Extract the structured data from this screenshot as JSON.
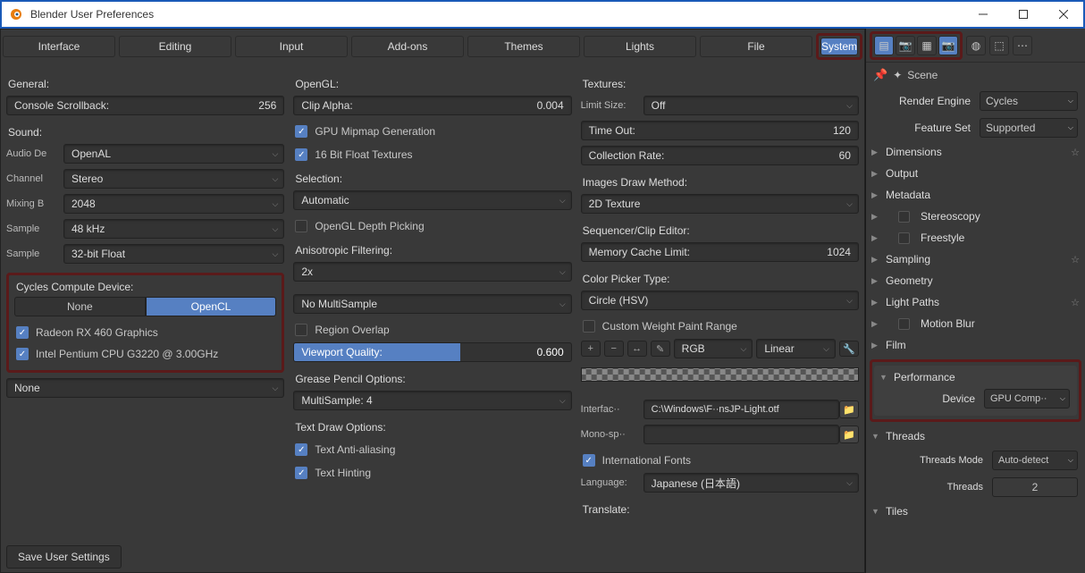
{
  "window_title": "Blender User Preferences",
  "tabs": [
    "Interface",
    "Editing",
    "Input",
    "Add-ons",
    "Themes",
    "Lights",
    "File",
    "System"
  ],
  "col1": {
    "general": "General:",
    "console_scrollback_label": "Console Scrollback:",
    "console_scrollback_value": "256",
    "sound": "Sound:",
    "audio_de_label": "Audio De",
    "audio_de_value": "OpenAL",
    "channel_label": "Channel",
    "channel_value": "Stereo",
    "mixing_label": "Mixing B",
    "mixing_value": "2048",
    "sample_rate_label": "Sample",
    "sample_rate_value": "48 kHz",
    "sample_fmt_label": "Sample",
    "sample_fmt_value": "32-bit Float",
    "compute_title": "Cycles Compute Device:",
    "compute_none": "None",
    "compute_opencl": "OpenCL",
    "device1": "Radeon RX 460 Graphics",
    "device2": "Intel Pentium CPU G3220 @ 3.00GHz",
    "none_select": "None"
  },
  "col2": {
    "opengl": "OpenGL:",
    "clip_alpha_label": "Clip Alpha:",
    "clip_alpha_value": "0.004",
    "gpu_mipmap": "GPU Mipmap Generation",
    "float_tex": "16 Bit Float Textures",
    "selection": "Selection:",
    "selection_value": "Automatic",
    "depth_picking": "OpenGL Depth Picking",
    "aniso": "Anisotropic Filtering:",
    "aniso_value": "2x",
    "multisample": "No MultiSample",
    "region_overlap": "Region Overlap",
    "viewport_quality_label": "Viewport Quality:",
    "viewport_quality_value": "0.600",
    "grease": "Grease Pencil Options:",
    "grease_value": "MultiSample: 4",
    "text_draw": "Text Draw Options:",
    "text_aa": "Text Anti-aliasing",
    "text_hint": "Text Hinting"
  },
  "col3": {
    "textures": "Textures:",
    "limit_size_label": "Limit Size:",
    "limit_size_value": "Off",
    "timeout_label": "Time Out:",
    "timeout_value": "120",
    "collection_label": "Collection Rate:",
    "collection_value": "60",
    "images_draw": "Images Draw Method:",
    "images_draw_value": "2D Texture",
    "sequencer": "Sequencer/Clip Editor:",
    "memcache_label": "Memory Cache Limit:",
    "memcache_value": "1024",
    "color_picker": "Color Picker Type:",
    "color_picker_value": "Circle (HSV)",
    "custom_weight": "Custom Weight Paint Range",
    "rgb": "RGB",
    "linear": "Linear",
    "interface_font_label": "Interfac··",
    "interface_font_value": "C:\\Windows\\F··nsJP-Light.otf",
    "mono_label": "Mono-sp··",
    "intl_fonts": "International Fonts",
    "language_label": "Language:",
    "language_value": "Japanese (日本語)",
    "translate": "Translate:"
  },
  "save_btn": "Save User Settings",
  "props": {
    "scene": "Scene",
    "render_engine_label": "Render Engine",
    "render_engine_value": "Cycles",
    "feature_set_label": "Feature Set",
    "feature_set_value": "Supported",
    "dimensions": "Dimensions",
    "output": "Output",
    "metadata": "Metadata",
    "stereoscopy": "Stereoscopy",
    "freestyle": "Freestyle",
    "sampling": "Sampling",
    "geometry": "Geometry",
    "light_paths": "Light Paths",
    "motion_blur": "Motion Blur",
    "film": "Film",
    "performance": "Performance",
    "device_label": "Device",
    "device_value": "GPU Comp··",
    "threads": "Threads",
    "threads_mode_label": "Threads Mode",
    "threads_mode_value": "Auto-detect",
    "threads_num_label": "Threads",
    "threads_num_value": "2",
    "tiles": "Tiles"
  }
}
